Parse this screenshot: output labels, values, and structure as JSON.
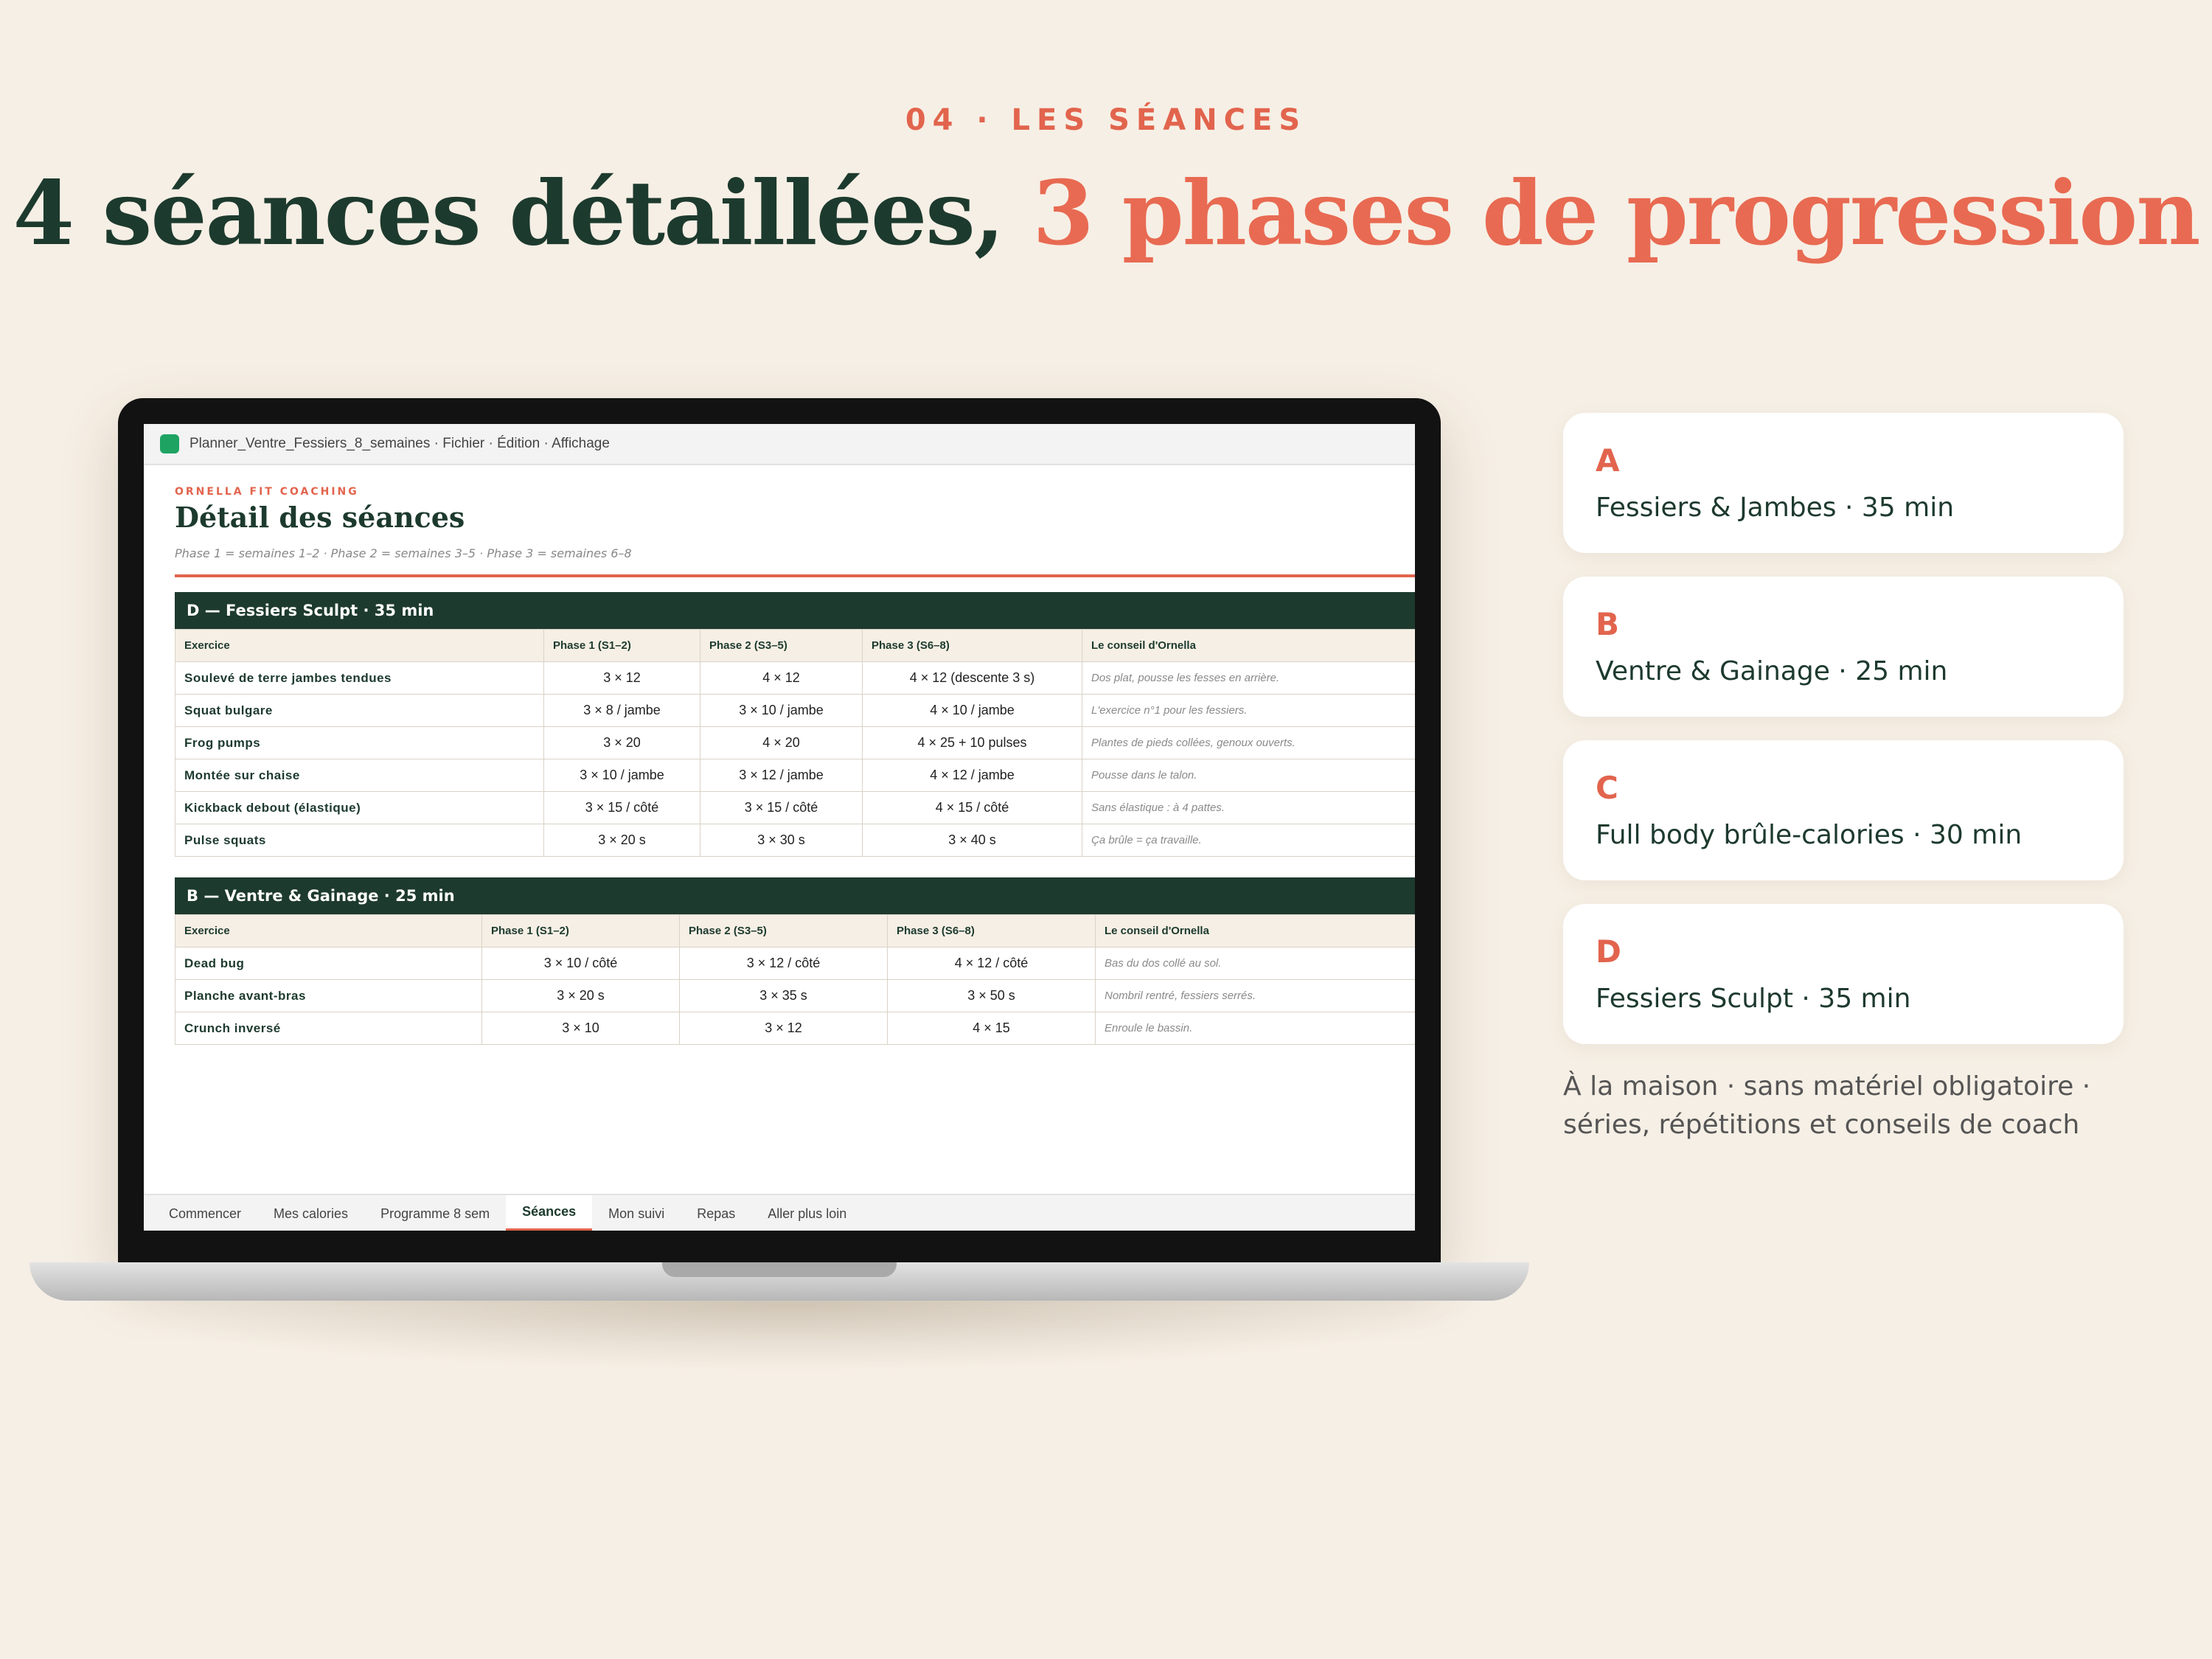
{
  "header": {
    "eyebrow": "04 · LES SÉANCES",
    "title_dark": "4 séances détaillées,",
    "title_accent": "3 phases de progression"
  },
  "colors": {
    "accent": "#e2644d",
    "dark_green": "#1d3a2e",
    "background": "#f6efe5"
  },
  "app": {
    "title": "Planner_Ventre_Fessiers_8_semaines · Fichier · Édition · Affichage",
    "icon": "sheet-app-icon"
  },
  "sheet": {
    "brand": "ORNELLA FIT COACHING",
    "title": "Détail des séances",
    "subtitle": "Phase 1 = semaines 1–2 · Phase 2 = semaines 3–5 · Phase 3 = semaines 6–8"
  },
  "sessions": [
    {
      "header": "D — Fessiers Sculpt · 35 min",
      "columns": [
        "Exercice",
        "Phase 1 (S1–2)",
        "Phase 2 (S3–5)",
        "Phase 3 (S6–8)",
        "Le conseil d'Ornella"
      ],
      "rows": [
        [
          "Soulevé de terre jambes tendues",
          "3 × 12",
          "4 × 12",
          "4 × 12 (descente 3 s)",
          "Dos plat, pousse les fesses en arrière."
        ],
        [
          "Squat bulgare",
          "3 × 8 / jambe",
          "3 × 10 / jambe",
          "4 × 10 / jambe",
          "L'exercice n°1 pour les fessiers."
        ],
        [
          "Frog pumps",
          "3 × 20",
          "4 × 20",
          "4 × 25 + 10 pulses",
          "Plantes de pieds collées, genoux ouverts."
        ],
        [
          "Montée sur chaise",
          "3 × 10 / jambe",
          "3 × 12 / jambe",
          "4 × 12 / jambe",
          "Pousse dans le talon."
        ],
        [
          "Kickback debout (élastique)",
          "3 × 15 / côté",
          "3 × 15 / côté",
          "4 × 15 / côté",
          "Sans élastique : à 4 pattes."
        ],
        [
          "Pulse squats",
          "3 × 20 s",
          "3 × 30 s",
          "3 × 40 s",
          "Ça brûle = ça travaille."
        ]
      ]
    },
    {
      "header": "B — Ventre & Gainage · 25 min",
      "columns": [
        "Exercice",
        "Phase 1 (S1–2)",
        "Phase 2 (S3–5)",
        "Phase 3 (S6–8)",
        "Le conseil d'Ornella"
      ],
      "rows": [
        [
          "Dead bug",
          "3 × 10 / côté",
          "3 × 12 / côté",
          "4 × 12 / côté",
          "Bas du dos collé au sol."
        ],
        [
          "Planche avant-bras",
          "3 × 20 s",
          "3 × 35 s",
          "3 × 50 s",
          "Nombril rentré, fessiers serrés."
        ],
        [
          "Crunch inversé",
          "3 × 10",
          "3 × 12",
          "4 × 15",
          "Enroule le bassin."
        ]
      ]
    }
  ],
  "tabs": [
    {
      "label": "Commencer",
      "active": false
    },
    {
      "label": "Mes calories",
      "active": false
    },
    {
      "label": "Programme 8 sem",
      "active": false
    },
    {
      "label": "Séances",
      "active": true
    },
    {
      "label": "Mon suivi",
      "active": false
    },
    {
      "label": "Repas",
      "active": false
    },
    {
      "label": "Aller plus loin",
      "active": false
    }
  ],
  "cards": [
    {
      "letter": "A",
      "label": "Fessiers & Jambes · 35 min"
    },
    {
      "letter": "B",
      "label": "Ventre & Gainage · 25 min"
    },
    {
      "letter": "C",
      "label": "Full body brûle-calories · 30 min"
    },
    {
      "letter": "D",
      "label": "Fessiers Sculpt · 35 min"
    }
  ],
  "footnote": "À la maison · sans matériel obligatoire · séries, répétitions et conseils de coach"
}
